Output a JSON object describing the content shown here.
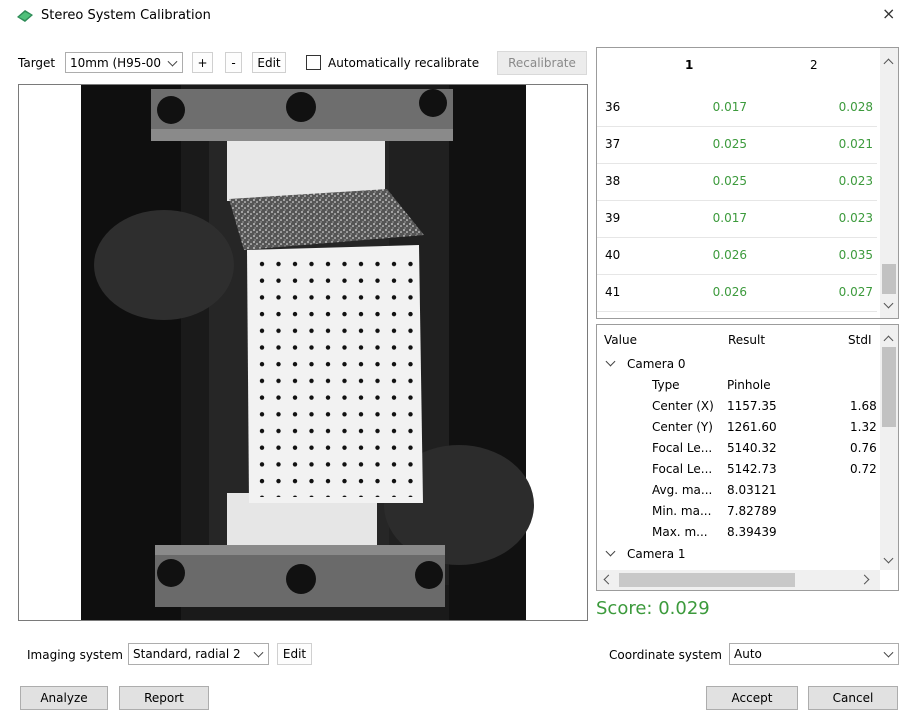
{
  "window": {
    "title": "Stereo System Calibration",
    "close_label": "×"
  },
  "toolbar": {
    "target_label": "Target",
    "target_value": "10mm (H95-00",
    "plus_label": "+",
    "minus_label": "-",
    "edit_label": "Edit",
    "auto_recalibrate_label": "Automatically recalibrate",
    "auto_recalibrate_checked": false,
    "recalibrate_label": "Recalibrate"
  },
  "table": {
    "columns": [
      "1",
      "2"
    ],
    "rows": [
      {
        "index": "36",
        "c1": "0.017",
        "c2": "0.028"
      },
      {
        "index": "37",
        "c1": "0.025",
        "c2": "0.021"
      },
      {
        "index": "38",
        "c1": "0.025",
        "c2": "0.023"
      },
      {
        "index": "39",
        "c1": "0.017",
        "c2": "0.023"
      },
      {
        "index": "40",
        "c1": "0.026",
        "c2": "0.035"
      },
      {
        "index": "41",
        "c1": "0.026",
        "c2": "0.027"
      }
    ]
  },
  "tree": {
    "headers": {
      "value": "Value",
      "result": "Result",
      "std": "StdI"
    },
    "camera0_label": "Camera 0",
    "camera0_items": [
      {
        "name": "Type",
        "result": "Pinhole",
        "std": ""
      },
      {
        "name": "Center (X)",
        "result": "1157.35",
        "std": "1.68"
      },
      {
        "name": "Center (Y)",
        "result": "1261.60",
        "std": "1.32"
      },
      {
        "name": "Focal Le...",
        "result": "5140.32",
        "std": "0.76"
      },
      {
        "name": "Focal Le...",
        "result": "5142.73",
        "std": "0.72"
      },
      {
        "name": "Avg. ma...",
        "result": "8.03121",
        "std": ""
      },
      {
        "name": "Min. ma...",
        "result": "7.82789",
        "std": ""
      },
      {
        "name": "Max. m...",
        "result": "8.39439",
        "std": ""
      }
    ],
    "camera1_label": "Camera 1"
  },
  "score": "Score: 0.029",
  "imaging": {
    "label": "Imaging system",
    "value": "Standard, radial 2",
    "edit_label": "Edit"
  },
  "coordinate": {
    "label": "Coordinate system",
    "value": "Auto"
  },
  "footer": {
    "analyze": "Analyze",
    "report": "Report",
    "accept": "Accept",
    "cancel": "Cancel"
  },
  "colors": {
    "green_values": "#3c9a3c",
    "score": "#3c9a3c",
    "app_icon": "#2e8b57"
  },
  "icons": [
    "app-icon",
    "close-icon",
    "chevron-down-icon",
    "checkbox",
    "scroll-up-icon",
    "scroll-down-icon",
    "scroll-left-icon",
    "scroll-right-icon",
    "expand-icon"
  ]
}
